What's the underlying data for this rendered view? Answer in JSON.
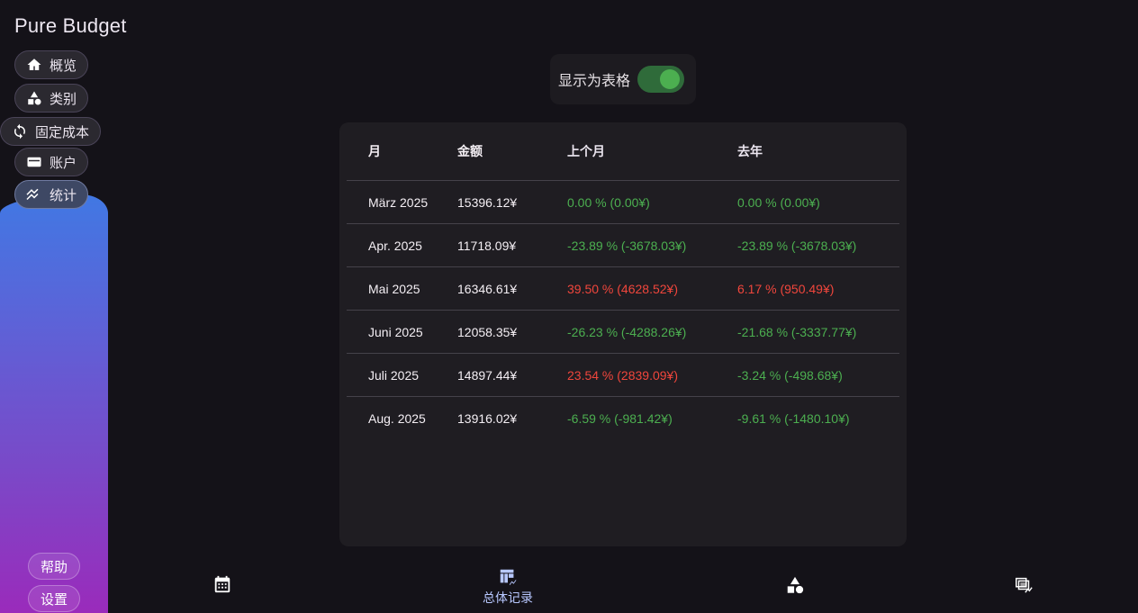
{
  "app_title": "Pure Budget",
  "sidebar": {
    "items": [
      {
        "label": "概览",
        "icon": "home-icon"
      },
      {
        "label": "类别",
        "icon": "shapes-icon"
      },
      {
        "label": "固定成本",
        "icon": "repeat-icon"
      },
      {
        "label": "账户",
        "icon": "wallet-icon"
      },
      {
        "label": "统计",
        "icon": "trending-icon",
        "active": true
      }
    ],
    "help_label": "帮助",
    "settings_label": "设置"
  },
  "toggle": {
    "label": "显示为表格",
    "on": true
  },
  "table": {
    "headers": [
      "月",
      "金额",
      "上个月",
      "去年"
    ],
    "rows": [
      {
        "month": "März 2025",
        "amount": "15396.12¥",
        "prev_month": "0.00 % (0.00¥)",
        "prev_month_color": "green",
        "last_year": "0.00 % (0.00¥)",
        "last_year_color": "green"
      },
      {
        "month": "Apr. 2025",
        "amount": "11718.09¥",
        "prev_month": "-23.89 % (-3678.03¥)",
        "prev_month_color": "green",
        "last_year": "-23.89 % (-3678.03¥)",
        "last_year_color": "green"
      },
      {
        "month": "Mai 2025",
        "amount": "16346.61¥",
        "prev_month": "39.50 % (4628.52¥)",
        "prev_month_color": "red",
        "last_year": "6.17 % (950.49¥)",
        "last_year_color": "red"
      },
      {
        "month": "Juni 2025",
        "amount": "12058.35¥",
        "prev_month": "-26.23 % (-4288.26¥)",
        "prev_month_color": "green",
        "last_year": "-21.68 % (-3337.77¥)",
        "last_year_color": "green"
      },
      {
        "month": "Juli 2025",
        "amount": "14897.44¥",
        "prev_month": "23.54 % (2839.09¥)",
        "prev_month_color": "red",
        "last_year": "-3.24 % (-498.68¥)",
        "last_year_color": "green"
      },
      {
        "month": "Aug. 2025",
        "amount": "13916.02¥",
        "prev_month": "-6.59 % (-981.42¥)",
        "prev_month_color": "green",
        "last_year": "-9.61 % (-1480.10¥)",
        "last_year_color": "green"
      }
    ]
  },
  "bottom_nav": {
    "items": [
      {
        "icon": "calendar-icon",
        "label": ""
      },
      {
        "icon": "table-chart-icon",
        "label": "总体记录",
        "active": true
      },
      {
        "icon": "shapes-icon",
        "label": ""
      },
      {
        "icon": "multi-chart-icon",
        "label": ""
      }
    ]
  },
  "colors": {
    "positive": "#4caf50",
    "negative": "#f0463c",
    "accent": "#b8c8ff",
    "toggle_track": "#2f6b3a"
  }
}
